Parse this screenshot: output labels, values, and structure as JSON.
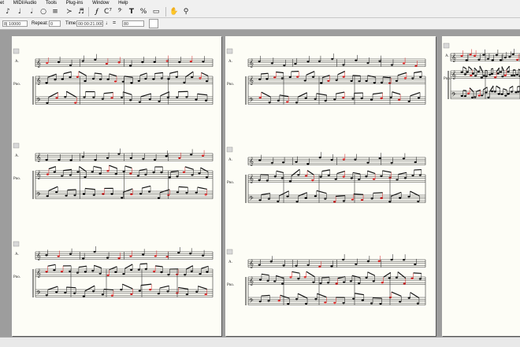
{
  "menubar": {
    "items": [
      "et",
      "MIDI/Audio",
      "Tools",
      "Plug-ins",
      "Window",
      "Help"
    ]
  },
  "toolbar": {
    "icons": [
      "eighth-note-icon",
      "quarter-note-icon",
      "half-note-icon",
      "whole-note-icon",
      "rest-icon",
      "accent-icon",
      "tuplet-icon",
      "dynamics-icon",
      "chord-symbol-icon",
      "bass-clef-icon",
      "text-icon",
      "percent-icon",
      "page-icon",
      "hand-icon",
      "zoom-icon"
    ]
  },
  "playback": {
    "position_value": "8| 10000",
    "repeat_label": "Repeat:",
    "repeat_value": "0",
    "time_label": "Time:",
    "time_value": "00:00:21.000",
    "tempo_symbol": "♩ =",
    "tempo_value": "80"
  },
  "score": {
    "instrument_top": "A.",
    "instrument_piano": "Pno."
  },
  "colors": {
    "page": "#fdfdf6",
    "workspace": "#9d9d9d",
    "annotation_red": "#d42424",
    "toolbar": "#f0f0f0"
  }
}
